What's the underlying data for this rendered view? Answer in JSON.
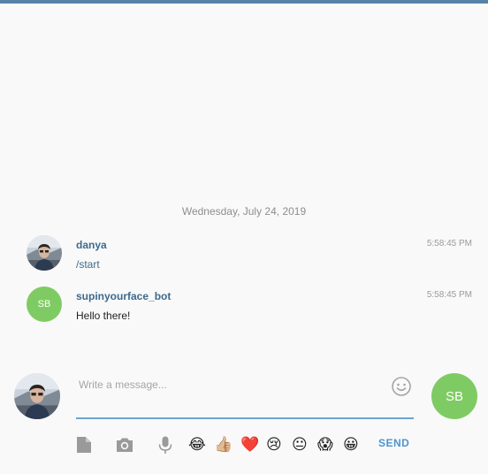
{
  "chat": {
    "date_separator": "Wednesday, July 24, 2019",
    "messages": [
      {
        "author": "danya",
        "text": "/start",
        "time": "5:58:45 PM",
        "avatar": "photo"
      },
      {
        "author": "supinyourface_bot",
        "text": "Hello there!",
        "time": "5:58:45 PM",
        "avatar_initials": "SB"
      }
    ]
  },
  "composer": {
    "placeholder": "Write a message...",
    "bot_initials": "SB",
    "send_label": "SEND",
    "emojis": [
      "😂",
      "👍🏼",
      "❤️",
      "😢",
      "😐",
      "😱",
      "😀"
    ]
  },
  "colors": {
    "accent": "#5583a8",
    "author": "#3d6a8e",
    "bot_avatar": "#7fcb63",
    "send": "#4d94cf"
  }
}
